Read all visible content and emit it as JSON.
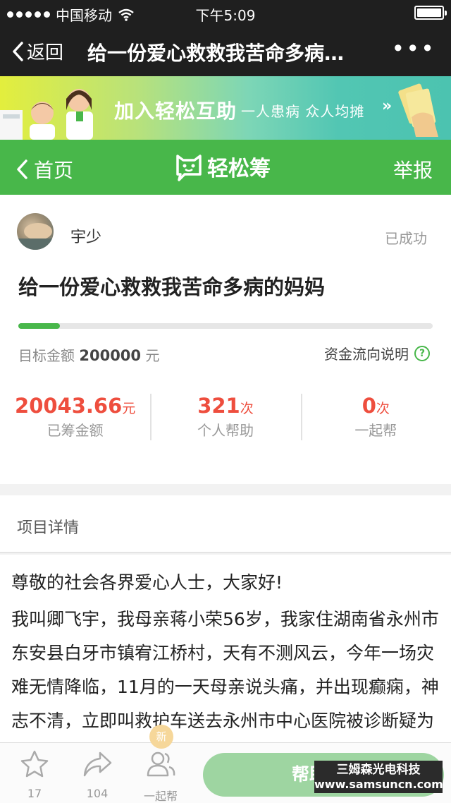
{
  "statusbar": {
    "carrier": "中国移动",
    "time": "下午5:09",
    "battery_level": 1.0
  },
  "wx_nav": {
    "back_label": "返回",
    "title": "给一份爱心救救我苦命多病…",
    "more_label": "•••"
  },
  "banner": {
    "main": "加入轻松互助",
    "sub": "一人患病 众人均摊",
    "arrow": "»"
  },
  "header": {
    "home_label": "首页",
    "logo_text": "轻松筹",
    "report_label": "举报"
  },
  "project": {
    "user_name": "宇少",
    "status": "已成功",
    "title": "给一份爱心救救我苦命多病的妈妈",
    "progress": 0.1,
    "target_label": "目标金额",
    "target_amount": "200000",
    "target_unit": "元",
    "fund_flow_label": "资金流向说明",
    "help_icon": "?"
  },
  "stats": [
    {
      "value": "20043.66",
      "unit": "元",
      "label": "已筹金额"
    },
    {
      "value": "321",
      "unit": "次",
      "label": "个人帮助"
    },
    {
      "value": "0",
      "unit": "次",
      "label": "一起帮"
    }
  ],
  "details": {
    "section_label": "项目详情",
    "paragraphs": [
      "尊敬的社会各界爱心人士，大家好!",
      "我叫卿飞宇，我母亲蒋小荣56岁，我家住湖南省永州市东安县白牙市镇宥江桥村，天有不测风云，今年一场灾难无情降临，11月的一天母亲说头痛，并出现癫痫，神志不清，立即叫救护车送去永州市中心医院被诊断疑为脑胶质瘤，刚开始我总不知道脑"
    ]
  },
  "bottombar": {
    "star_count": "17",
    "share_count": "104",
    "together_label": "一起帮",
    "new_badge": "新",
    "help_button": "帮助TA"
  },
  "watermark": {
    "line1": "三姆森光电科技",
    "line2": "www.samsuncn.com"
  },
  "colors": {
    "green": "#48b74a",
    "red": "#ee4e3e",
    "dark": "#1f1f1f"
  }
}
